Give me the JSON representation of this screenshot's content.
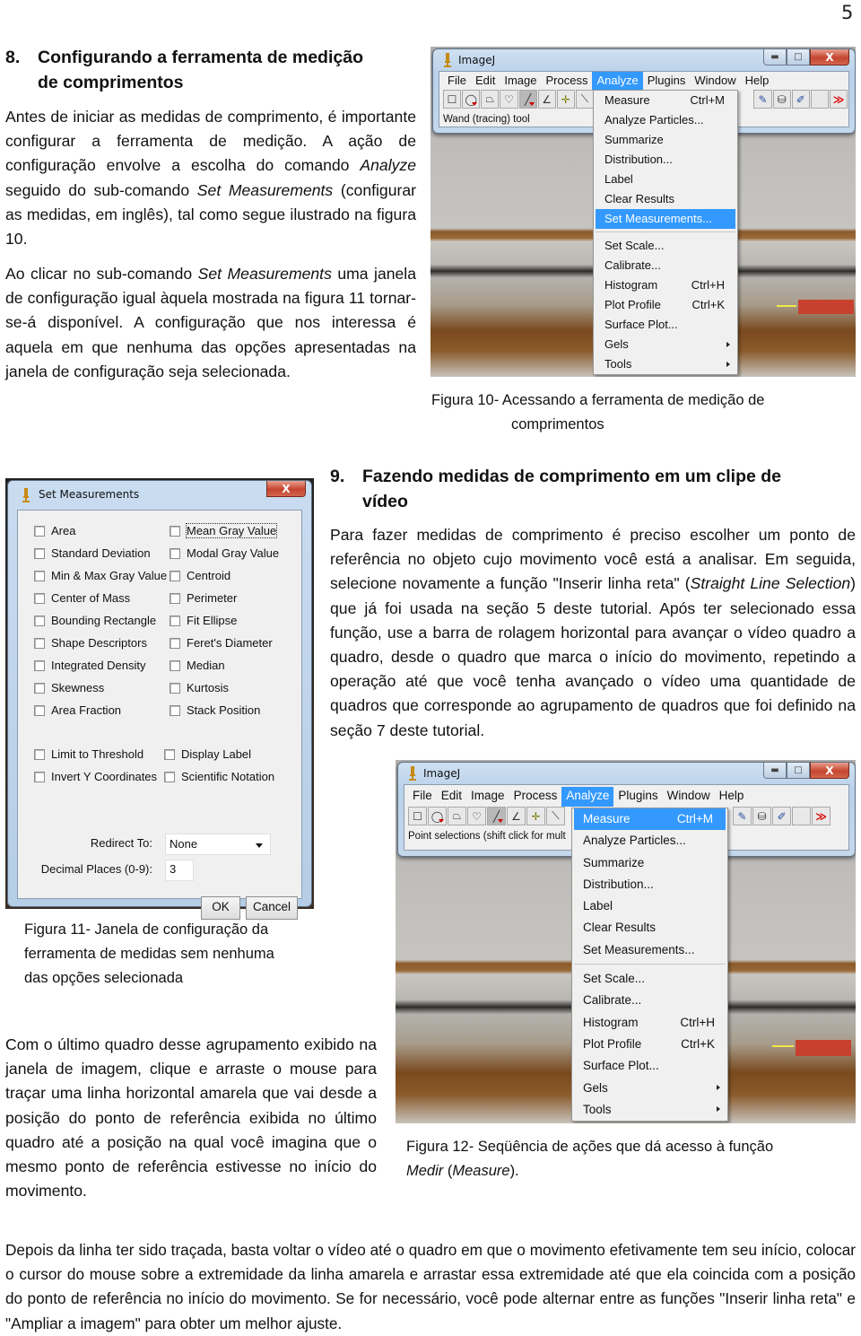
{
  "page_number": "5",
  "section8": {
    "number": "8.",
    "title_line1": "Configurando a ferramenta de medição",
    "title_line2": "de comprimentos",
    "para1": {
      "t1": "Antes de iniciar as medidas de comprimento, é importante configurar a ferramenta de medição. A ação de configuração envolve a escolha do comando ",
      "i1": "Analyze",
      "t2": " seguido do sub-comando ",
      "i2": "Set Measurements",
      "t3": " (configurar as medidas, em inglês), tal como segue ilustrado na figura 10."
    },
    "para2": {
      "t1": "Ao clicar no sub-comando ",
      "i1": "Set Measurements",
      "t2": " uma janela de configuração igual àquela mostrada na figura 11 tornar-se-á disponível. A configuração que nos interessa é aquela em que nenhuma das opções apresentadas na janela de configuração seja selecionada."
    }
  },
  "figure10": {
    "caption_line1": "Figura 10- Acessando a ferramenta de medição de",
    "caption_line2": "comprimentos",
    "window_title": "ImageJ",
    "menu": [
      "File",
      "Edit",
      "Image",
      "Process",
      "Analyze",
      "Plugins",
      "Window",
      "Help"
    ],
    "active_menu": "Analyze",
    "status_text": "Wand (tracing) tool",
    "dropdown": [
      {
        "label": "Measure",
        "shortcut": "Ctrl+M"
      },
      {
        "label": "Analyze Particles..."
      },
      {
        "label": "Summarize"
      },
      {
        "label": "Distribution..."
      },
      {
        "label": "Label"
      },
      {
        "label": "Clear Results"
      },
      {
        "label": "Set Measurements...",
        "highlighted": true
      },
      {
        "label": "Set Scale..."
      },
      {
        "label": "Calibrate..."
      },
      {
        "label": "Histogram",
        "shortcut": "Ctrl+H"
      },
      {
        "label": "Plot Profile",
        "shortcut": "Ctrl+K"
      },
      {
        "label": "Surface Plot..."
      },
      {
        "label": "Gels",
        "submenu": true
      },
      {
        "label": "Tools",
        "submenu": true
      }
    ]
  },
  "toolbar_icons": [
    "rectangle-tool",
    "oval-tool",
    "polygon-tool",
    "freehand-tool",
    "straight-line-tool",
    "angle-tool",
    "point-tool",
    "wand-tool",
    "brush-tool",
    "flood-fill-tool",
    "color-picker-tool",
    "more-tools"
  ],
  "figure11": {
    "caption_line1": "Figura 11- Janela de configuração da",
    "caption_line2": "ferramenta de medidas sem nenhuma",
    "caption_line3": "das opções selecionada",
    "dialog_title": "Set Measurements",
    "left_options": [
      "Area",
      "Standard Deviation",
      "Min & Max Gray Value",
      "Center of Mass",
      "Bounding Rectangle",
      "Shape Descriptors",
      "Integrated Density",
      "Skewness",
      "Area Fraction"
    ],
    "right_options": [
      "Mean Gray Value",
      "Modal Gray Value",
      "Centroid",
      "Perimeter",
      "Fit Ellipse",
      "Feret's Diameter",
      "Median",
      "Kurtosis",
      "Stack Position"
    ],
    "extra_left": [
      "Limit to Threshold",
      "Invert Y Coordinates"
    ],
    "extra_right": [
      "Display Label",
      "Scientific Notation"
    ],
    "all_checked": false,
    "redirect_label": "Redirect To:",
    "redirect_value": "None",
    "decimal_label": "Decimal Places (0-9):",
    "decimal_value": "3",
    "ok_label": "OK",
    "cancel_label": "Cancel"
  },
  "section9": {
    "number": "9.",
    "title_line1": "Fazendo medidas de comprimento em um clipe de",
    "title_line2": "vídeo",
    "para1": {
      "t1": "Para fazer medidas de comprimento é preciso escolher um ponto de referência no objeto cujo movimento você está a analisar. Em seguida, selecione novamente a função \"Inserir linha reta\" (",
      "i1": "Straight Line Selection",
      "t2": ") que já foi usada na seção 5 deste tutorial. Após ter selecionado essa função, use a barra de rolagem horizontal para avançar o vídeo quadro a quadro, desde o quadro que marca o início do movimento, repetindo a operação até que você tenha avançado o vídeo uma quantidade de quadros que corresponde ao agrupamento de quadros que foi definido na seção 7 deste tutorial."
    },
    "para2": "Com o último quadro desse agrupamento exibido na janela de imagem, clique e arraste o mouse para traçar uma linha horizontal amarela que vai desde a posição do ponto de referência exibida no último quadro até a posição na qual você imagina que o mesmo ponto de referência estivesse no início do movimento.",
    "para3": "Depois da linha ter sido traçada, basta voltar o vídeo até o quadro em que o movimento efetivamente tem seu início, colocar o cursor do mouse sobre a extremidade da linha amarela e arrastar essa extremidade até que ela coincida com a posição do ponto de referência no início do movimento. Se for necessário, você pode alternar entre as funções \"Inserir linha reta\" e \"Ampliar a imagem\" para obter um melhor ajuste."
  },
  "figure12": {
    "caption_line1": "Figura 12- Seqüência de ações que dá acesso à função",
    "caption_italic1": "Medir",
    "caption_mid": " (",
    "caption_italic2": "Measure",
    "caption_end": ").",
    "window_title": "ImageJ",
    "menu": [
      "File",
      "Edit",
      "Image",
      "Process",
      "Analyze",
      "Plugins",
      "Window",
      "Help"
    ],
    "active_menu": "Analyze",
    "status_text": "Point selections (shift click for mult",
    "dropdown": [
      {
        "label": "Measure",
        "shortcut": "Ctrl+M",
        "highlighted": true
      },
      {
        "label": "Analyze Particles..."
      },
      {
        "label": "Summarize"
      },
      {
        "label": "Distribution..."
      },
      {
        "label": "Label"
      },
      {
        "label": "Clear Results"
      },
      {
        "label": "Set Measurements..."
      },
      {
        "label": "Set Scale..."
      },
      {
        "label": "Calibrate..."
      },
      {
        "label": "Histogram",
        "shortcut": "Ctrl+H"
      },
      {
        "label": "Plot Profile",
        "shortcut": "Ctrl+K"
      },
      {
        "label": "Surface Plot..."
      },
      {
        "label": "Gels",
        "submenu": true
      },
      {
        "label": "Tools",
        "submenu": true
      }
    ]
  }
}
